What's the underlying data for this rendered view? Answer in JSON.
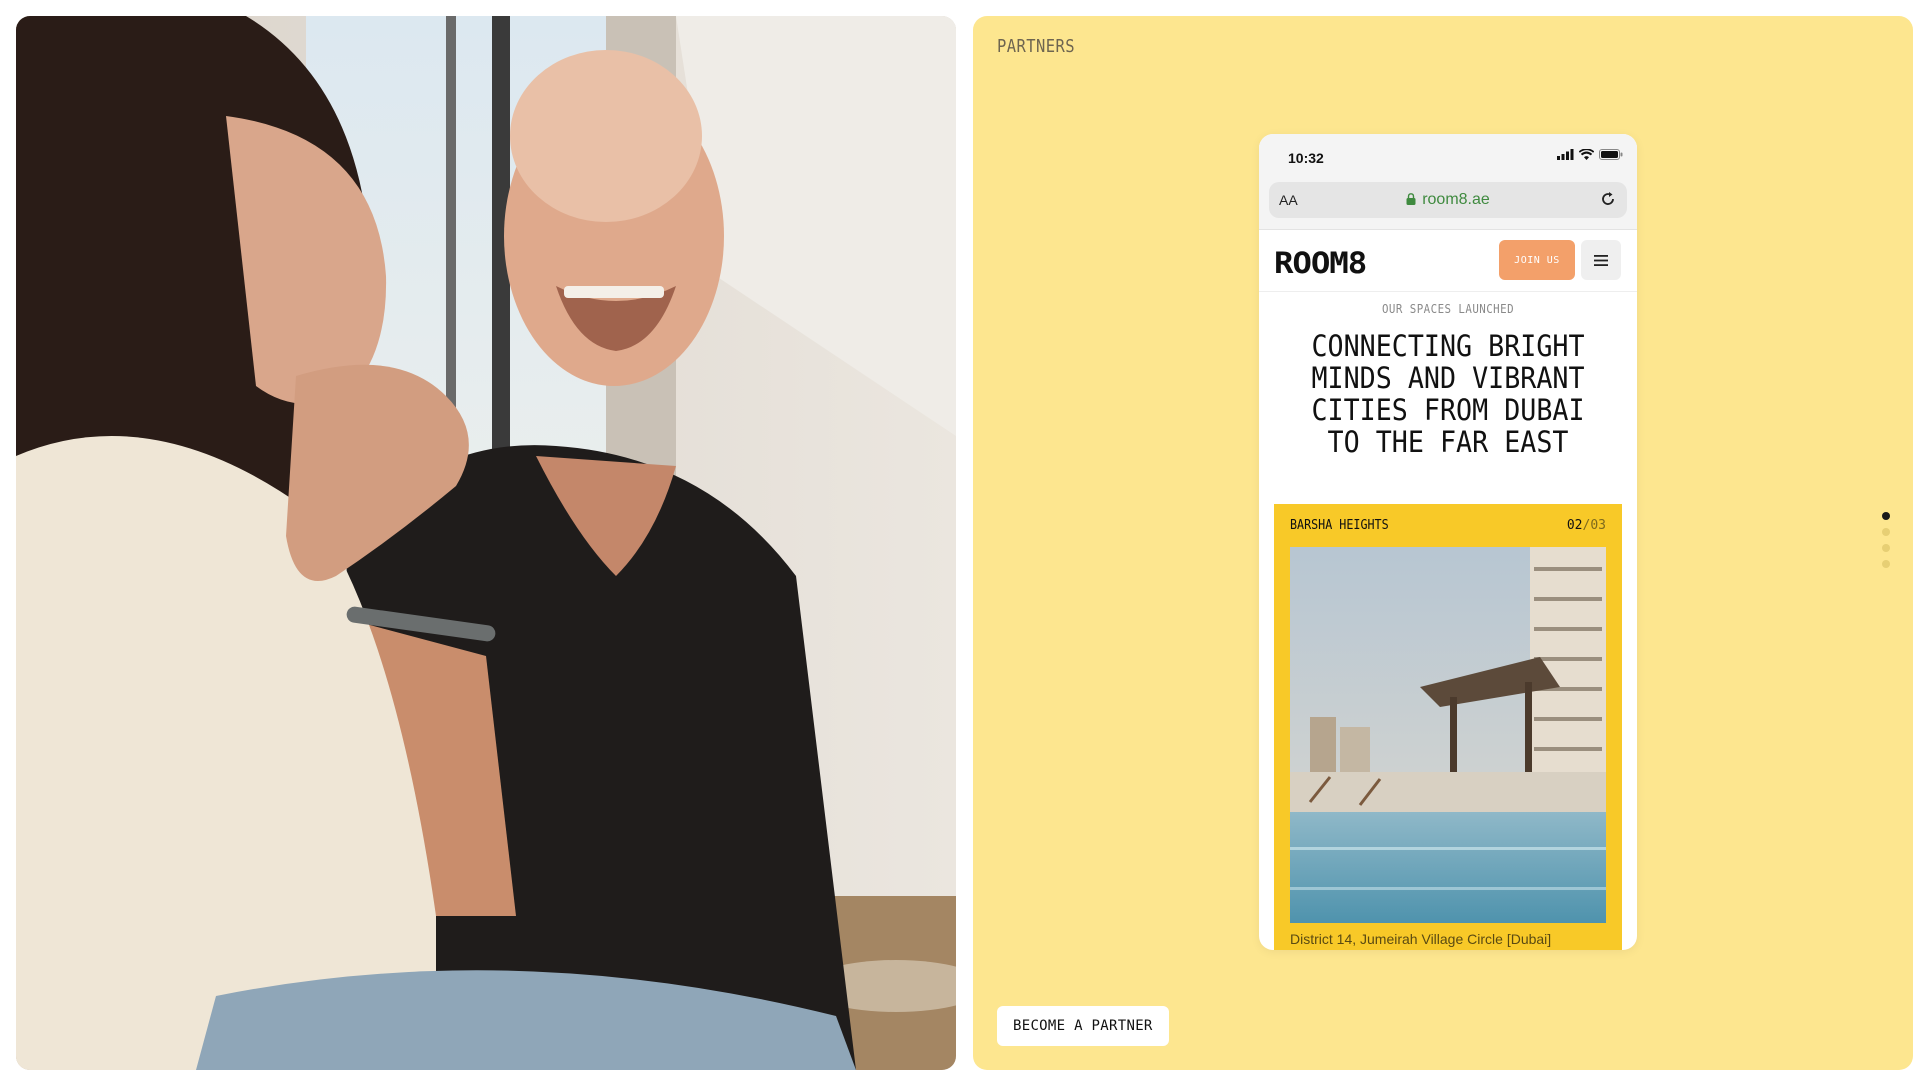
{
  "colors": {
    "panel_yellow": "#fde68f",
    "card_yellow": "#f8c928",
    "join_button": "#f3a06a",
    "url_green": "#3f8a3f"
  },
  "photo": {
    "icon": "photo-two-people-laughing"
  },
  "partners": {
    "title": "PARTNERS",
    "cta_label": "BECOME A PARTNER",
    "pager": {
      "total": 4,
      "active_index": 0
    }
  },
  "phone": {
    "status": {
      "time": "10:32",
      "icons": [
        "signal-icon",
        "wifi-icon",
        "battery-icon"
      ]
    },
    "browser": {
      "text_size_label": "AA",
      "url": "room8.ae",
      "icons": [
        "lock-icon",
        "reload-icon"
      ]
    },
    "site": {
      "logo": "ROOM8",
      "join_label": "JOIN US",
      "menu_icon": "hamburger-menu-icon",
      "kicker": "OUR SPACES LAUNCHED",
      "headline": "CONNECTING BRIGHT MINDS AND VIBRANT CITIES FROM DUBAI TO THE FAR EAST",
      "location": {
        "name": "BARSHA HEIGHTS",
        "count_current": "02",
        "count_sep": "/",
        "count_total": "03",
        "address": "District 14, Jumeirah Village Circle [Dubai]"
      }
    }
  }
}
